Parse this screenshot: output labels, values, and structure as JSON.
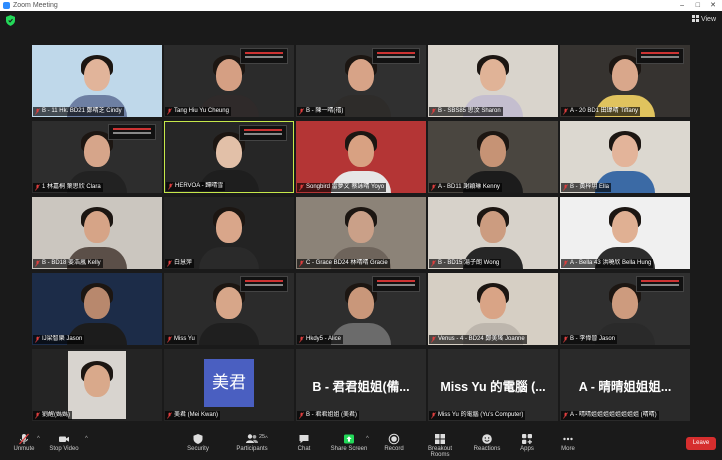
{
  "window": {
    "title": "Zoom Meeting"
  },
  "topbar": {
    "view_label": "View"
  },
  "tiles": [
    {
      "name": "B - 11 Hk. BD21 鄭晴芝 Cindy",
      "kind": "video",
      "bg": "#bfd8ea",
      "face": "#e1b49a",
      "body": "#6d7fa3"
    },
    {
      "name": "Tang Hiu Yu Cheung",
      "kind": "video",
      "bg": "#2b2b2b",
      "face": "#d59f83",
      "body": "#2f2a2a",
      "banner": true
    },
    {
      "name": "B - 陳一晴(禧)",
      "kind": "video",
      "bg": "#303030",
      "face": "#d7a387",
      "body": "#2e2c2a",
      "banner": true
    },
    {
      "name": "B - SBS85 思汶 Sharon",
      "kind": "video",
      "bg": "#d9d4cc",
      "face": "#e0b397",
      "body": "#c4becf"
    },
    {
      "name": "A - 20 BD1 田瑋晴 Tiffany",
      "kind": "video",
      "bg": "#363330",
      "face": "#d9a78b",
      "body": "#e0c35e",
      "banner": true
    },
    {
      "name": "1 林嘉桐 葉思欣 Clara",
      "kind": "video",
      "bg": "#2d2d2d",
      "face": "#d6a58a",
      "body": "#222",
      "banner": true
    },
    {
      "name": "HERVOA - 歸晴雪",
      "kind": "video",
      "bg": "#262626",
      "face": "#e2c0a8",
      "body": "#1e1e1e",
      "active": true,
      "banner": true
    },
    {
      "name": "Songbird 雷夢文 蔡詠晴 Yoyo",
      "kind": "video",
      "bg": "#b43535",
      "face": "#d8a182",
      "body": "#e6e6e6"
    },
    {
      "name": "A - BD11 謝穎琳 Kenny",
      "kind": "video",
      "bg": "#4a4640",
      "face": "#c69375",
      "body": "#1c1c1c"
    },
    {
      "name": "B - 黃梓玥 Ella",
      "kind": "video",
      "bg": "#dcd8d0",
      "face": "#e3b49a",
      "body": "#3b6aa5"
    },
    {
      "name": "B - BD18 姜浩嵐 Kelly",
      "kind": "video",
      "bg": "#cbc6bf",
      "face": "#d6a487",
      "body": "#5b4f48"
    },
    {
      "name": "白慧萍",
      "kind": "video",
      "bg": "#232323",
      "face": "#d9a68a",
      "body": "#2a2a2a"
    },
    {
      "name": "C - Grace BD24 林晴晴 Gracie",
      "kind": "video",
      "bg": "#8c8378",
      "face": "#caa088",
      "body": "#6e645b"
    },
    {
      "name": "B - BD15 湯子朗 Wong",
      "kind": "video",
      "bg": "#d7d2ca",
      "face": "#cc9c80",
      "body": "#262626"
    },
    {
      "name": "A - Bella 43 洪曉欣 Bella Hung",
      "kind": "video",
      "bg": "#f0f0f0",
      "face": "#e0b093",
      "body": "#2d2d2d"
    },
    {
      "name": "IJ梁智樂 Jason",
      "kind": "video",
      "bg": "#1c2c48",
      "face": "#b8886d",
      "body": "#1c1c1c"
    },
    {
      "name": "Miss Yu",
      "kind": "video",
      "bg": "#2b2b2b",
      "face": "#d7a689",
      "body": "#1f1f1f",
      "banner": true
    },
    {
      "name": "Hkdy5 - Alice",
      "kind": "video",
      "bg": "#2e2e2e",
      "face": "#c9977a",
      "body": "#6b6b6b",
      "banner": true
    },
    {
      "name": "Venus - 4 - BD24 鄭美瑤 Joanne",
      "kind": "video",
      "bg": "#d6cfc4",
      "face": "#d9a486",
      "body": "#bdb6ad"
    },
    {
      "name": "B - 李偉晉 Jason",
      "kind": "video",
      "bg": "#2f2f2f",
      "face": "#cd9b7e",
      "body": "#2a2a2a",
      "banner": true
    },
    {
      "name": "劉醒(媽媽)",
      "kind": "photo",
      "bg": "#2a2a2a"
    },
    {
      "name": "美君 (Mei Kwan)",
      "kind": "avatar",
      "avatar_text": "美君"
    },
    {
      "name": "B - 君君姐姐 (美君)",
      "kind": "text",
      "big": "B - 君君姐姐(備..."
    },
    {
      "name": "Miss Yu 的電腦 (Yu's Computer)",
      "kind": "text",
      "big": "Miss Yu 的電腦 (..."
    },
    {
      "name": "A - 晴晴姐姐姐姐姐姐姐姐 (晴晴)",
      "kind": "text",
      "big": "A - 晴晴姐姐姐..."
    }
  ],
  "toolbar": {
    "items": [
      {
        "id": "unmute",
        "label": "Unmute"
      },
      {
        "id": "video",
        "label": "Stop Video"
      },
      {
        "id": "security",
        "label": "Security"
      },
      {
        "id": "participants",
        "label": "Participants",
        "count": "25"
      },
      {
        "id": "chat",
        "label": "Chat"
      },
      {
        "id": "share",
        "label": "Share Screen"
      },
      {
        "id": "record",
        "label": "Record"
      },
      {
        "id": "breakout",
        "label": "Breakout Rooms"
      },
      {
        "id": "reactions",
        "label": "Reactions"
      },
      {
        "id": "apps",
        "label": "Apps"
      },
      {
        "id": "more",
        "label": "More"
      }
    ],
    "leave_label": "Leave"
  },
  "colors": {
    "accent": "#2d8cff",
    "active_speaker": "#c6e84a",
    "leave": "#d62e2e",
    "share": "#23d959",
    "muted": "#e03e3e"
  }
}
